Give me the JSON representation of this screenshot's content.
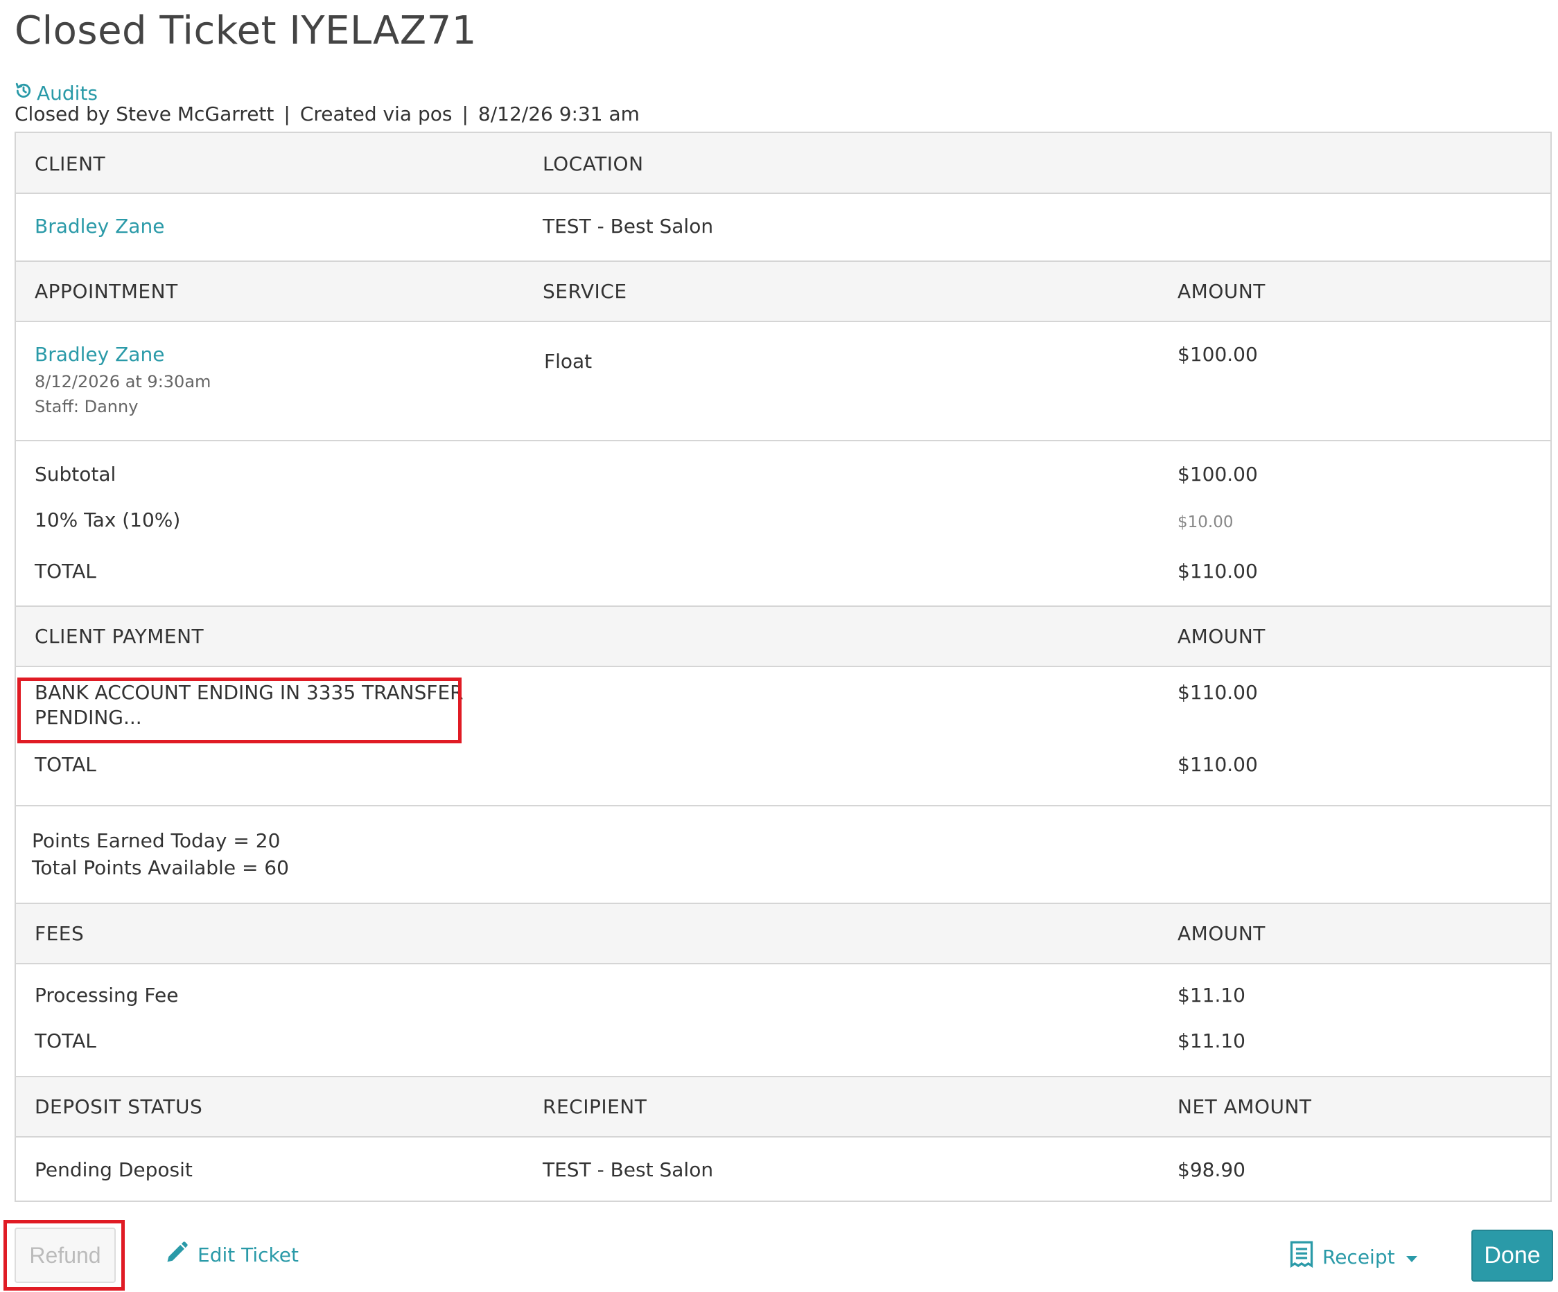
{
  "page": {
    "title": "Closed Ticket IYELAZ71",
    "audits_label": "Audits",
    "meta": {
      "closed_by": "Closed by Steve McGarrett",
      "created_via": "Created via pos",
      "datetime": "8/12/26 9:31 am",
      "separator": "|"
    }
  },
  "client_section": {
    "headers": {
      "client": "CLIENT",
      "location": "LOCATION"
    },
    "client_name": "Bradley Zane",
    "location": "TEST - Best Salon"
  },
  "appointment_section": {
    "headers": {
      "appointment": "APPOINTMENT",
      "service": "SERVICE",
      "amount": "AMOUNT"
    },
    "client_name": "Bradley Zane",
    "date": "8/12/2026 at 9:30am",
    "staff": "Staff: Danny",
    "service": "Float",
    "amount": "$100.00"
  },
  "totals": {
    "subtotal_label": "Subtotal",
    "subtotal": "$100.00",
    "tax_label": "10% Tax (10%)",
    "tax": "$10.00",
    "total_label": "TOTAL",
    "total": "$110.00"
  },
  "payment_section": {
    "headers": {
      "client_payment": "CLIENT PAYMENT",
      "amount": "AMOUNT"
    },
    "method_line1": "BANK ACCOUNT ENDING IN 3335 TRANSFER",
    "method_line2": "PENDING...",
    "method_amount": "$110.00",
    "total_label": "TOTAL",
    "total": "$110.00"
  },
  "points": {
    "earned_today": "Points Earned Today = 20",
    "total_available": "Total Points Available = 60"
  },
  "fees_section": {
    "headers": {
      "fees": "FEES",
      "amount": "AMOUNT"
    },
    "processing_label": "Processing Fee",
    "processing": "$11.10",
    "total_label": "TOTAL",
    "total": "$11.10"
  },
  "deposit_section": {
    "headers": {
      "status": "DEPOSIT STATUS",
      "recipient": "RECIPIENT",
      "net_amount": "NET AMOUNT"
    },
    "status": "Pending Deposit",
    "recipient": "TEST - Best Salon",
    "net_amount": "$98.90"
  },
  "footer": {
    "refund_label": "Refund",
    "edit_label": "Edit Ticket",
    "receipt_label": "Receipt",
    "done_label": "Done"
  },
  "colors": {
    "accent": "#2a9aa8",
    "highlight_box": "#e01b24",
    "header_bg": "#f5f5f5"
  },
  "icons": {
    "audits": "history-icon",
    "edit": "pencil-icon",
    "receipt": "receipt-icon",
    "receipt_dropdown": "caret-down-icon"
  }
}
